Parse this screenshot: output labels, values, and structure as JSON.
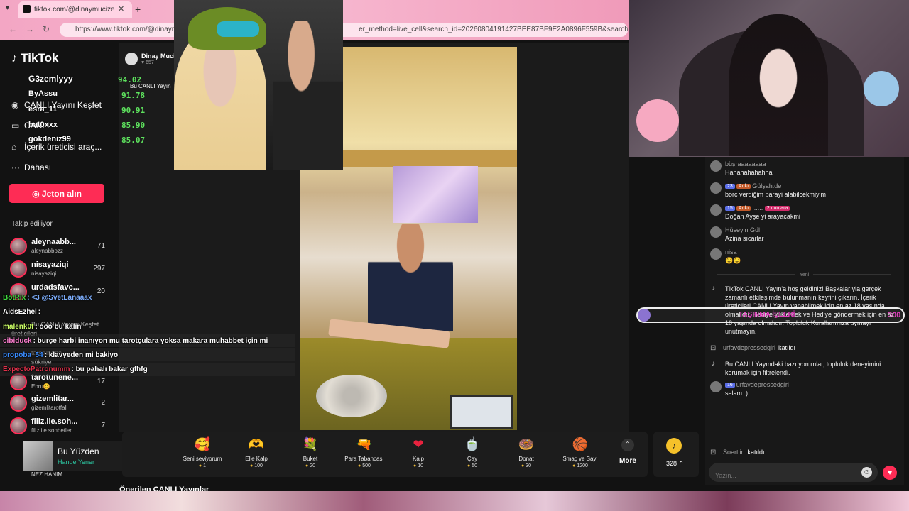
{
  "browser": {
    "tab_title": "tiktok.com/@dinaymucize",
    "url": "https://www.tiktok.com/@dinaym",
    "url_tail": "er_method=live_cell&search_id=20260804191427BEE87BF9E2A0896F559B&search_keyword=TAR"
  },
  "sidebar": {
    "logo": "TikTok",
    "top_overlays": [
      "G3zemlyyy",
      "ByAssu",
      "esra_11",
      "bat0xxx",
      "gokdeniz99"
    ],
    "nav": [
      {
        "label": "CANLI Yayını Keşfet",
        "icon": "live-icon"
      },
      {
        "label": "CANLI",
        "icon": "camera-icon"
      },
      {
        "label": "İçerik üreticisi araç...",
        "icon": "creator-icon"
      },
      {
        "label": "Dahası",
        "icon": "more-icon"
      }
    ],
    "jeton_label": "Jeton alın",
    "following_header": "Takip ediliyor",
    "following": [
      {
        "name": "aleynaabb...",
        "handle": "aleynabbozz",
        "count": "71"
      },
      {
        "name": "nisayaziqi",
        "handle": "nisayaziqi",
        "count": "297"
      },
      {
        "name": "urdadsfavc...",
        "handle": "",
        "count": "20"
      },
      {
        "name": "tarotunene...",
        "handle": "Ebru😊",
        "count": "17"
      },
      {
        "name": "gizemlitar...",
        "handle": "gizemlitarotfall",
        "count": "2"
      },
      {
        "name": "filiz.ile.soh...",
        "handle": "filiz.ile.sohbetler",
        "count": "7"
      }
    ]
  },
  "host": {
    "name": "Dinay Mucize",
    "likes": "657",
    "tag": "Bu CANLI Yayın"
  },
  "scores": [
    "94.02",
    "91.78",
    "90.91",
    "85.90",
    "85.07"
  ],
  "overlay_chat": [
    {
      "user": "BotRix",
      "text": ": <3 @SvetLanaaax",
      "color": "#3fe03f"
    },
    {
      "user": "AidsEzhel",
      "text": ":",
      "color": "#e8e8e8"
    },
    {
      "user": "malenk0f",
      "text": ": ooo bu kalın",
      "color": "#e8e8e8"
    },
    {
      "user": "cibiduck",
      "text": ": burçe harbi inanıyon mu tarotçulara yoksa makara muhabbet için mi",
      "color": "#ff7fd1"
    },
    {
      "user": "propoba_54",
      "text": ": klavyeden mi bakiyo",
      "color": "#3a8cff"
    },
    {
      "user": "ExpectoPatronumm",
      "text": ": bu pahalı bakar gfhfg",
      "color": "#e0304a"
    }
  ],
  "ghost_texts": [
    "Bu CANLI Yayını Keşfet",
    "üreticileri",
    "tarotunene",
    "şükriye"
  ],
  "song": {
    "title": "Bu Yüzden",
    "artist": "Hande Yener",
    "footer": "NEZ HANIM ..."
  },
  "gifts": [
    {
      "name": "Seni seviyorum",
      "price": "1",
      "icon": "heart-face-icon",
      "glyph": "🥰"
    },
    {
      "name": "Elle Kalp",
      "price": "100",
      "icon": "hand-heart-icon",
      "glyph": "🫶"
    },
    {
      "name": "Buket",
      "price": "20",
      "icon": "bouquet-icon",
      "glyph": "💐"
    },
    {
      "name": "Para Tabancası",
      "price": "500",
      "icon": "money-gun-icon",
      "glyph": "🔫"
    },
    {
      "name": "Kalp",
      "price": "10",
      "icon": "heart-icon",
      "glyph": "❤"
    },
    {
      "name": "Çay",
      "price": "50",
      "icon": "tea-icon",
      "glyph": "🍵"
    },
    {
      "name": "Donat",
      "price": "30",
      "icon": "donut-icon",
      "glyph": "🍩"
    },
    {
      "name": "Smaç ve Sayı",
      "price": "1200",
      "icon": "basketball-icon",
      "glyph": "🏀"
    }
  ],
  "more_label": "More",
  "coins": "328",
  "recommended": "Önerilen CANLI Yayınlar",
  "chat": {
    "messages": [
      {
        "user": "büşraaaaaaaa",
        "text": "Hahahahahahha",
        "badges": []
      },
      {
        "user": "Gülşah.de",
        "text": "borc verdiğim parayi alabilcekmiyim",
        "badges": [
          {
            "t": "23",
            "c": "blue"
          },
          {
            "t": "Arıkı",
            "c": "orange"
          }
        ]
      },
      {
        "user": "......",
        "text": "Doğan Ayşe yi arayacakmi",
        "badges": [
          {
            "t": "15",
            "c": "blue"
          },
          {
            "t": "Arıkı",
            "c": "orange"
          },
          {
            "t": "2 numara",
            "c": "pink"
          }
        ]
      },
      {
        "user": "Hüseyin Gül",
        "text": "Azina sıcarlar",
        "badges": []
      },
      {
        "user": "nisa",
        "text": "😉😉",
        "badges": []
      }
    ],
    "new_label": "Yeni",
    "system_welcome": "TikTok CANLI Yayın'a hoş geldiniz! Başkalarıyla gerçek zamanlı etkileşimde bulunmanın keyfini çıkarın. İçerik üreticileri CANLI Yayın yapabilmek için en az 18 yaşında olmalıdır. Hediye yüklemek ve Hediye göndermek için en az 18 yaşında olmalıdır. Topluluk Kurallarımıza uymayı unutmayın.",
    "join1_user": "urfavdepressedgirl",
    "join1_action": "katıldı",
    "system_filter": "Bu CANLI Yayındaki bazı yorumlar, topluluk deneyimini korumak için filtrelendi.",
    "last_user": "urfavdepressedgirl",
    "last_badge": "16",
    "last_text": "selam :)",
    "join2_user": "Soertlin",
    "join2_action": "katıldı",
    "input_placeholder": "Yazın..."
  },
  "overlay_bar": {
    "label": "TAŞINMA İŞLERİ",
    "value": "300"
  },
  "colors": {
    "accent": "#fe2c55",
    "score_green": "#5ee35e",
    "bar_magenta": "#e23cbd"
  }
}
